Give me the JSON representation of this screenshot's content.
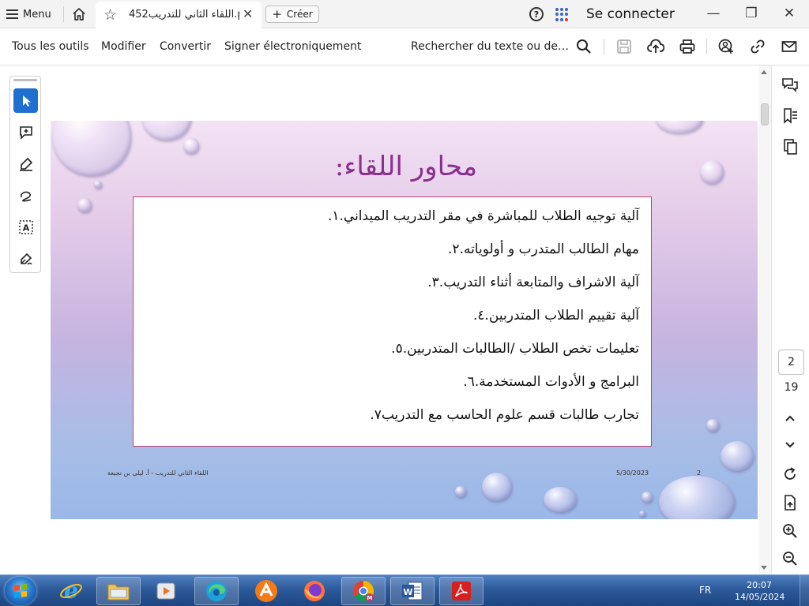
{
  "topbar": {
    "menu_label": "Menu",
    "tab_title": "اللقاء الثاني للتدريب452.pdf",
    "tab_close": "✕",
    "create_label": "Créer",
    "help_glyph": "?",
    "signin_label": "Se connecter",
    "window_controls": {
      "minimize": "—",
      "restore": "❐",
      "close": "✕"
    }
  },
  "toolbar": {
    "all_tools": "Tous les outils",
    "edit": "Modifier",
    "convert": "Convertir",
    "sign": "Signer électroniquement",
    "search_placeholder": "Rechercher du texte ou des outils"
  },
  "left_tools": {
    "items": [
      "select-tool",
      "add-comment-tool",
      "highlight-tool",
      "draw-tool",
      "text-recognition-tool",
      "sign-tool"
    ],
    "active": "select-tool"
  },
  "slide": {
    "title": "محاور اللقاء:",
    "items": [
      {
        "num": "١.",
        "text": "آلية توجيه الطلاب للمباشرة في مقر التدريب الميداني."
      },
      {
        "num": "٢.",
        "text": "مهام الطالب المتدرب و أولوياته."
      },
      {
        "num": "٣.",
        "text": "آلية الاشراف والمتابعة أثناء التدريب."
      },
      {
        "num": "٤.",
        "text": "آلية تقييم الطلاب المتدربين."
      },
      {
        "num": "٥.",
        "text": "تعليمات تخص الطلاب /الطالبات المتدربين."
      },
      {
        "num": "٦.",
        "text": "البرامج و الأدوات المستخدمة."
      },
      {
        "num": "٧.",
        "text": "تجارب طالبات قسم علوم الحاسب مع التدريب"
      }
    ],
    "footer_left": "اللقاء الثاني للتدريب - أ. ليلى بن نجيعة",
    "footer_date": "5/30/2023",
    "footer_page": "2",
    "colors": {
      "title": "#8a2f8e",
      "box_border": "#c2417a"
    }
  },
  "right_panel": {
    "current_page": "2",
    "total_pages": "19"
  },
  "taskbar": {
    "apps": [
      "internet-explorer",
      "file-explorer",
      "media-player",
      "edge",
      "avast",
      "firefox",
      "chrome",
      "word",
      "acrobat"
    ],
    "language": "FR",
    "time": "20:07",
    "date": "14/05/2024"
  },
  "accent": "#1f6fd1"
}
